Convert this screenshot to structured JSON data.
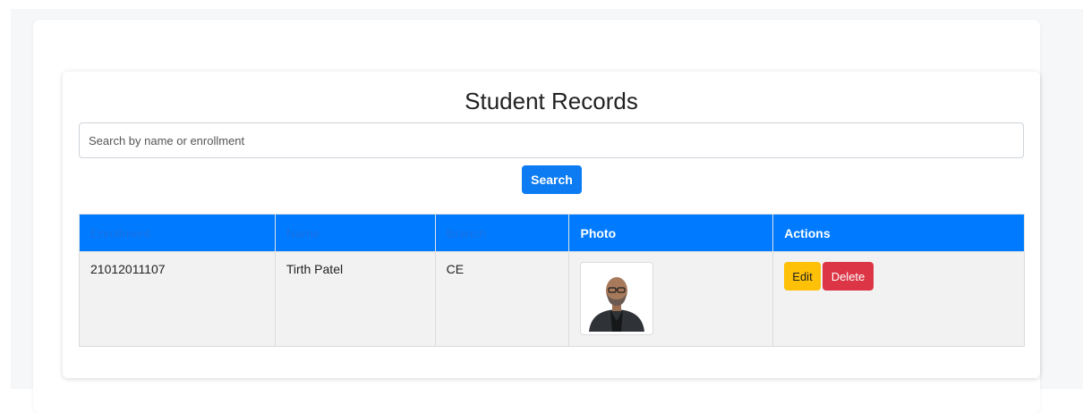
{
  "page": {
    "title": "Student Records"
  },
  "search": {
    "placeholder": "Search by name or enrollment",
    "value": "",
    "button_label": "Search"
  },
  "table": {
    "headers": {
      "enrollment": "Enrollment",
      "name": "Name",
      "branch": "Branch",
      "photo": "Photo",
      "actions": "Actions"
    },
    "rows": [
      {
        "enrollment": "21012011107",
        "name": "Tirth Patel",
        "branch": "CE",
        "edit_label": "Edit",
        "delete_label": "Delete"
      }
    ]
  },
  "colors": {
    "header_bg": "#007bff",
    "search_button": "#0d7cf2",
    "edit_button": "#ffc107",
    "delete_button": "#dc3545",
    "row_bg": "#f2f2f2"
  },
  "icons": {
    "photo": "student-photo"
  }
}
